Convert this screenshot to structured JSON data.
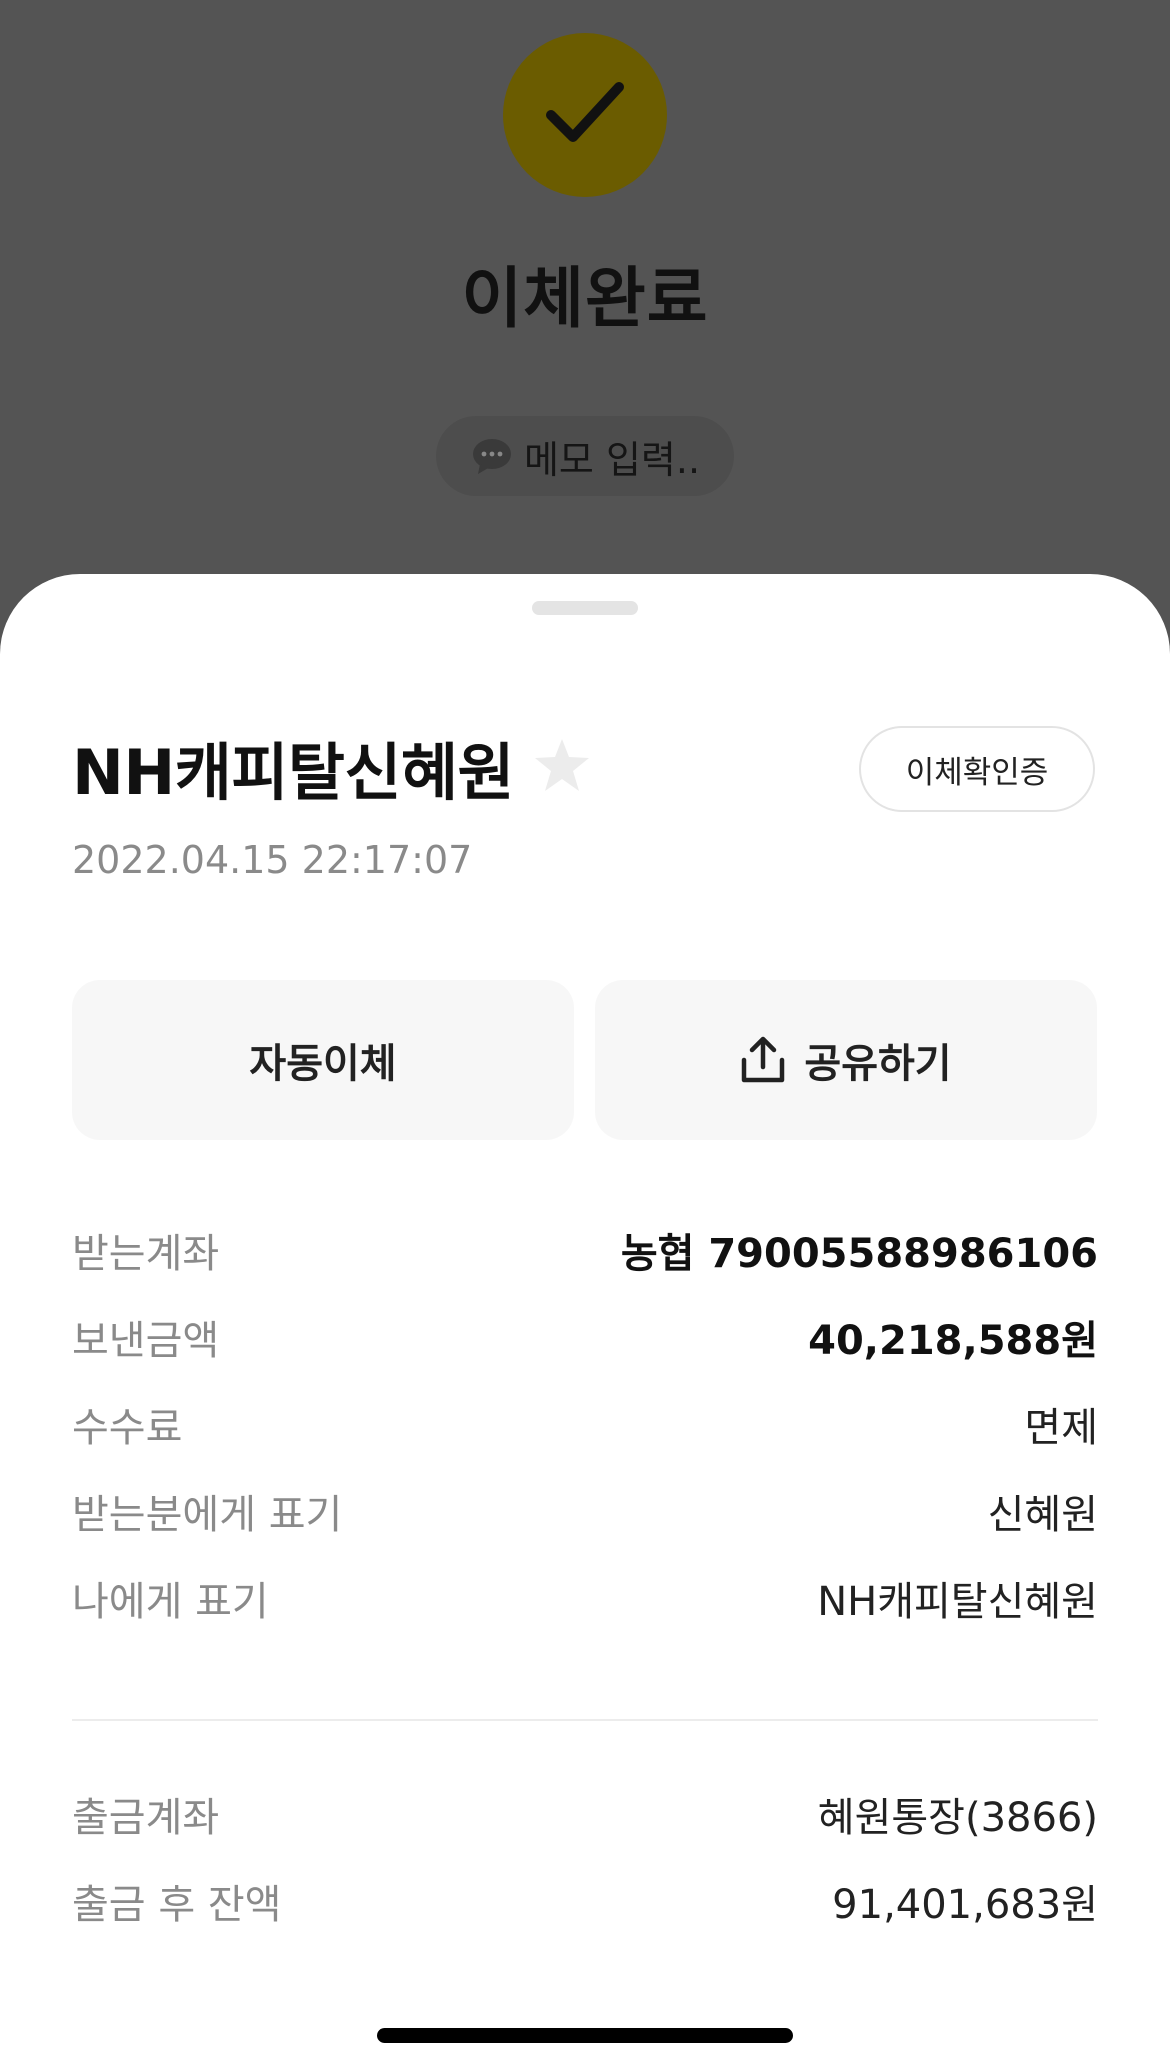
{
  "header": {
    "title": "이체완료",
    "memo_placeholder": "메모 입력.."
  },
  "sheet": {
    "recipient_name": "NH캐피탈신혜원",
    "confirm_button_label": "이체확인증",
    "datetime": "2022.04.15 22:17:07",
    "auto_transfer_label": "자동이체",
    "share_label": "공유하기"
  },
  "details": [
    {
      "label": "받는계좌",
      "value": "농협 79005588986106"
    },
    {
      "label": "보낸금액",
      "value": "40,218,588원"
    },
    {
      "label": "수수료",
      "value": "면제"
    },
    {
      "label": "받는분에게 표기",
      "value": "신혜원"
    },
    {
      "label": "나에게 표기",
      "value": "NH캐피탈신혜원"
    }
  ],
  "account_details": [
    {
      "label": "출금계좌",
      "value": "혜원통장(3866)"
    },
    {
      "label": "출금 후 잔액",
      "value": "91,401,683원"
    }
  ],
  "icons": {
    "check": "check-icon",
    "memo": "speech-bubble-icon",
    "star": "star-icon",
    "share": "share-upload-icon"
  },
  "colors": {
    "overlay": "#545454",
    "check_circle": "#6b5c00",
    "sheet_background": "#ffffff",
    "label_gray": "#8a8a8a"
  }
}
